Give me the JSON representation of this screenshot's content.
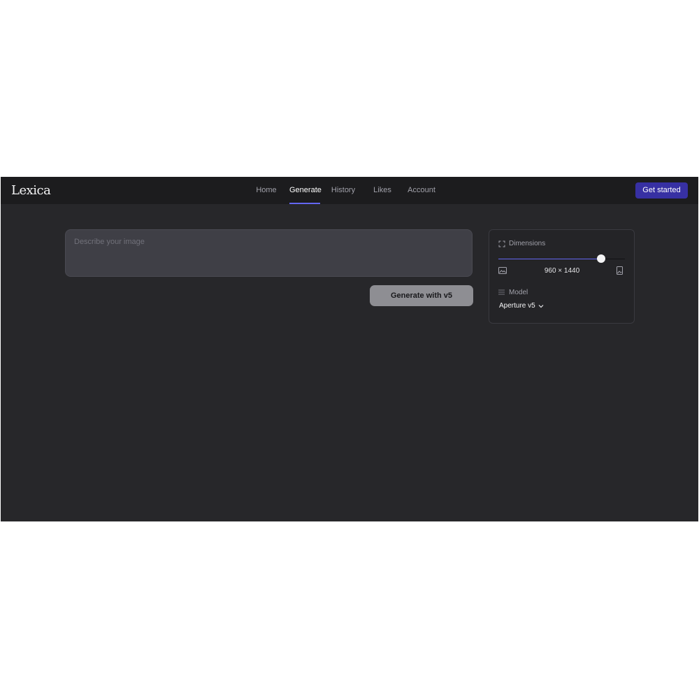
{
  "app": {
    "logo": "Lexica",
    "nav": [
      {
        "label": "Home",
        "active": false
      },
      {
        "label": "Generate",
        "active": true
      },
      {
        "label": "History",
        "active": false
      },
      {
        "label": "Likes",
        "active": false
      },
      {
        "label": "Account",
        "active": false
      }
    ],
    "cta_label": "Get started",
    "accent_color": "#6366f1",
    "cta_color": "#3730a3"
  },
  "prompt": {
    "placeholder": "Describe your image",
    "value": ""
  },
  "generate_button": {
    "label": "Generate with v5"
  },
  "settings": {
    "dimensions": {
      "label": "Dimensions",
      "icon": "expand-icon",
      "value_text": "960 × 1440",
      "slider_fraction": 0.81,
      "left_icon": "landscape-image-icon",
      "right_icon": "portrait-image-icon"
    },
    "model": {
      "label": "Model",
      "icon": "list-icon",
      "selected": "Aperture v5"
    }
  }
}
